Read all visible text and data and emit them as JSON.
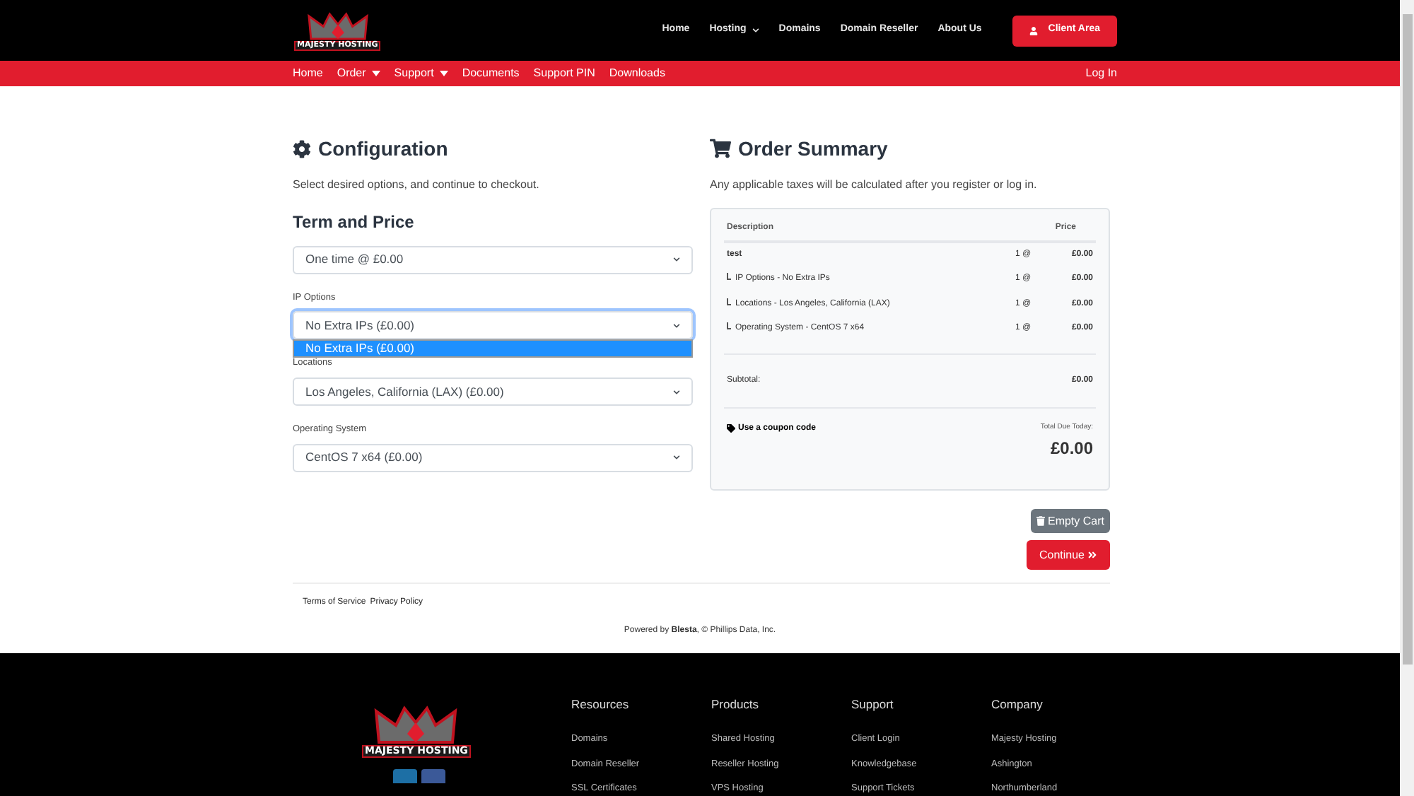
{
  "header": {
    "logo": "MAJESTY HOSTING",
    "nav": [
      {
        "label": "Home",
        "dropdown": false
      },
      {
        "label": "Hosting",
        "dropdown": true
      },
      {
        "label": "Domains",
        "dropdown": false
      },
      {
        "label": "Domain Reseller",
        "dropdown": false
      },
      {
        "label": "About Us",
        "dropdown": false
      }
    ],
    "client_button": "Client Area"
  },
  "subnav": {
    "items": [
      {
        "label": "Home",
        "dropdown": false
      },
      {
        "label": "Order",
        "dropdown": true
      },
      {
        "label": "Support",
        "dropdown": true
      },
      {
        "label": "Documents",
        "dropdown": false
      },
      {
        "label": "Support PIN",
        "dropdown": false
      },
      {
        "label": "Downloads",
        "dropdown": false
      }
    ],
    "login": "Log In"
  },
  "config": {
    "title": "Configuration",
    "intro": "Select desired options, and continue to checkout.",
    "term_title": "Term and Price",
    "term_value": "One time @ £0.00",
    "fields": [
      {
        "label": "IP Options",
        "value": "No Extra IPs (£0.00)",
        "expanded": true,
        "options": [
          {
            "label": "No Extra IPs (£0.00)",
            "selected": true
          }
        ]
      },
      {
        "label": "Locations",
        "value": "Los Angeles, California (LAX) (£0.00)",
        "expanded": false
      },
      {
        "label": "Operating System",
        "value": "CentOS 7 x64 (£0.00)",
        "expanded": false
      }
    ]
  },
  "summary": {
    "title": "Order Summary",
    "note": "Any applicable taxes will be calculated after you register or log in.",
    "columns": [
      "Description",
      "Price"
    ],
    "rows": [
      {
        "kind": "product",
        "description": "test",
        "qty": "1 @",
        "price": "£0.00"
      },
      {
        "kind": "option",
        "description": "IP Options - No Extra IPs",
        "qty": "1 @",
        "price": "£0.00"
      },
      {
        "kind": "option",
        "description": "Locations - Los Angeles, California (LAX)",
        "qty": "1 @",
        "price": "£0.00"
      },
      {
        "kind": "option",
        "description": "Operating System - CentOS 7 x64",
        "qty": "1 @",
        "price": "£0.00"
      }
    ],
    "subtotal_label": "Subtotal:",
    "subtotal": "£0.00",
    "coupon": "Use a coupon code",
    "total_label": "Total Due Today:",
    "total": "£0.00"
  },
  "buttons": {
    "empty_cart": "Empty Cart",
    "continue": "Continue"
  },
  "footer_links": [
    "Terms of Service",
    "Privacy Policy"
  ],
  "powered": "Powered by **Blesta**, © Phillips Data, Inc.",
  "footer": {
    "logo": "MAJESTY HOSTING",
    "columns": [
      {
        "title": "Resources",
        "links": [
          "Domains",
          "Domain Reseller",
          "SSL Certificates"
        ]
      },
      {
        "title": "Products",
        "links": [
          "Shared Hosting",
          "Reseller Hosting",
          "VPS Hosting"
        ]
      },
      {
        "title": "Support",
        "links": [
          "Client Login",
          "Knowledgebase",
          "Support Tickets"
        ]
      },
      {
        "title": "Company",
        "links": [
          "Majesty Hosting",
          "Ashington",
          "Northumberland"
        ]
      }
    ]
  }
}
